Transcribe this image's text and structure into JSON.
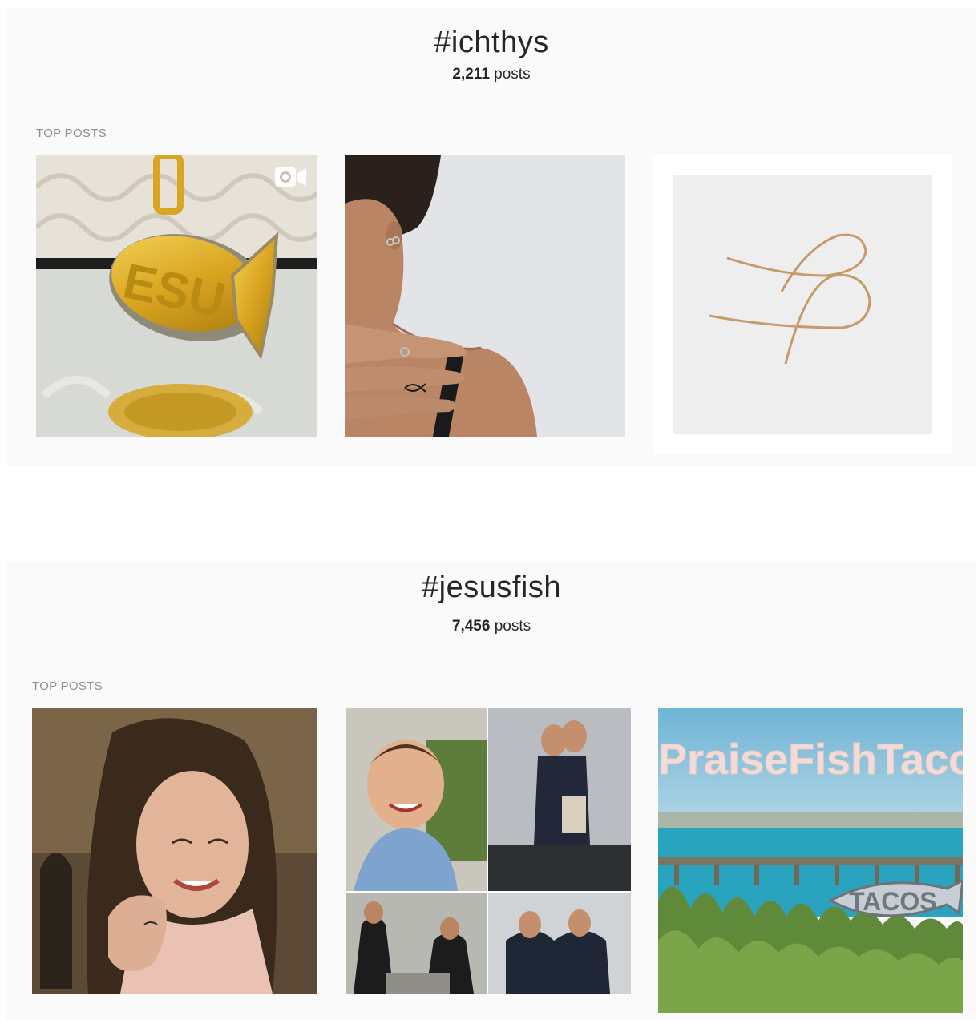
{
  "sections": [
    {
      "hashtag": "#ichthys",
      "post_count": "2,211",
      "posts_word": "posts",
      "top_posts_label": "TOP POSTS",
      "posts": [
        {
          "subject": "gold ichthys pendant with diamonds",
          "media": "video",
          "icon": "video-camera-icon"
        },
        {
          "subject": "woman's hand with ichthys finger tattoo"
        },
        {
          "subject": "gold wire ichthys earrings"
        }
      ]
    },
    {
      "hashtag": "#jesusfish",
      "post_count": "7,456",
      "posts_word": "posts",
      "top_posts_label": "TOP POSTS",
      "posts": [
        {
          "subject": "smiling girl showing ichthys finger tattoo"
        },
        {
          "subject": "baptism photo collage"
        },
        {
          "subject": "seaside pier with fish sign",
          "overlay_text": "PraiseFishTacos",
          "sign_text": "TACOS"
        }
      ]
    }
  ]
}
